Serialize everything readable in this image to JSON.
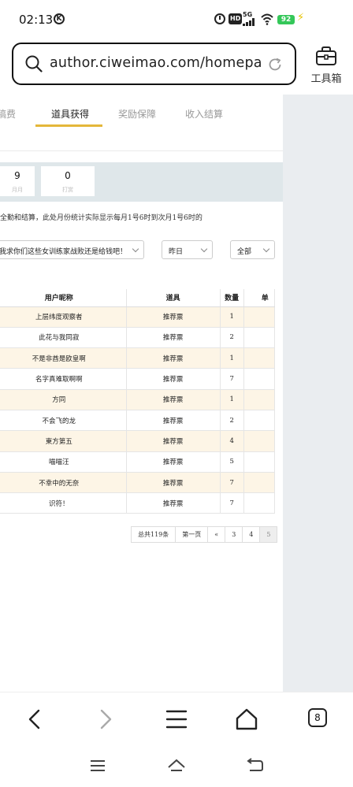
{
  "status": {
    "time": "02:13",
    "k_badge": "K",
    "hd": "HD",
    "net": "5G",
    "battery": "92",
    "icons": [
      "k-icon",
      "alarm-icon",
      "hd-icon",
      "signal-icon",
      "wifi-icon",
      "battery-icon",
      "charging-icon"
    ]
  },
  "browser": {
    "url": "author.ciweimao.com/homepa…",
    "toolbox_label": "工具箱",
    "tab_count": "8",
    "nav_icons": [
      "back-icon",
      "forward-icon",
      "menu-icon",
      "home-icon",
      "tabs-icon"
    ]
  },
  "page": {
    "tabs": [
      {
        "label": "稿费",
        "active": false
      },
      {
        "label": "道具获得",
        "active": true
      },
      {
        "label": "奖励保障",
        "active": false
      },
      {
        "label": "收入结算",
        "active": false
      }
    ],
    "stats": [
      {
        "value": "9",
        "label": "月月"
      },
      {
        "value": "0",
        "label": "打赏"
      }
    ],
    "note": "全勤和结算，此处月份统计实际显示每月1号6时到次月1号6时的",
    "filters": {
      "book": "我求你们这些女训练家战败还是给钱吧！",
      "date": "昨日",
      "type": "全部"
    },
    "table": {
      "columns": [
        "用户昵称",
        "道具",
        "数量",
        "单"
      ],
      "rows": [
        {
          "user": "上层纬度观察者",
          "item": "推荐票",
          "qty": "1"
        },
        {
          "user": "此花与我同寂",
          "item": "推荐票",
          "qty": "2"
        },
        {
          "user": "不是非酋是欧皇啊",
          "item": "推荐票",
          "qty": "1"
        },
        {
          "user": "名字真难取啊啊",
          "item": "推荐票",
          "qty": "7"
        },
        {
          "user": "方同",
          "item": "推荐票",
          "qty": "1"
        },
        {
          "user": "不会飞的龙",
          "item": "推荐票",
          "qty": "2"
        },
        {
          "user": "東方第五",
          "item": "推荐票",
          "qty": "4"
        },
        {
          "user": "喵喵汪",
          "item": "推荐票",
          "qty": "5"
        },
        {
          "user": "不幸中的无奈",
          "item": "推荐票",
          "qty": "7"
        },
        {
          "user": "识符！",
          "item": "推荐票",
          "qty": "7"
        }
      ]
    },
    "pager": {
      "total": "总共119条",
      "first": "第一页",
      "prev": "«",
      "pages": [
        "3",
        "4",
        "5"
      ],
      "current": "5"
    }
  }
}
